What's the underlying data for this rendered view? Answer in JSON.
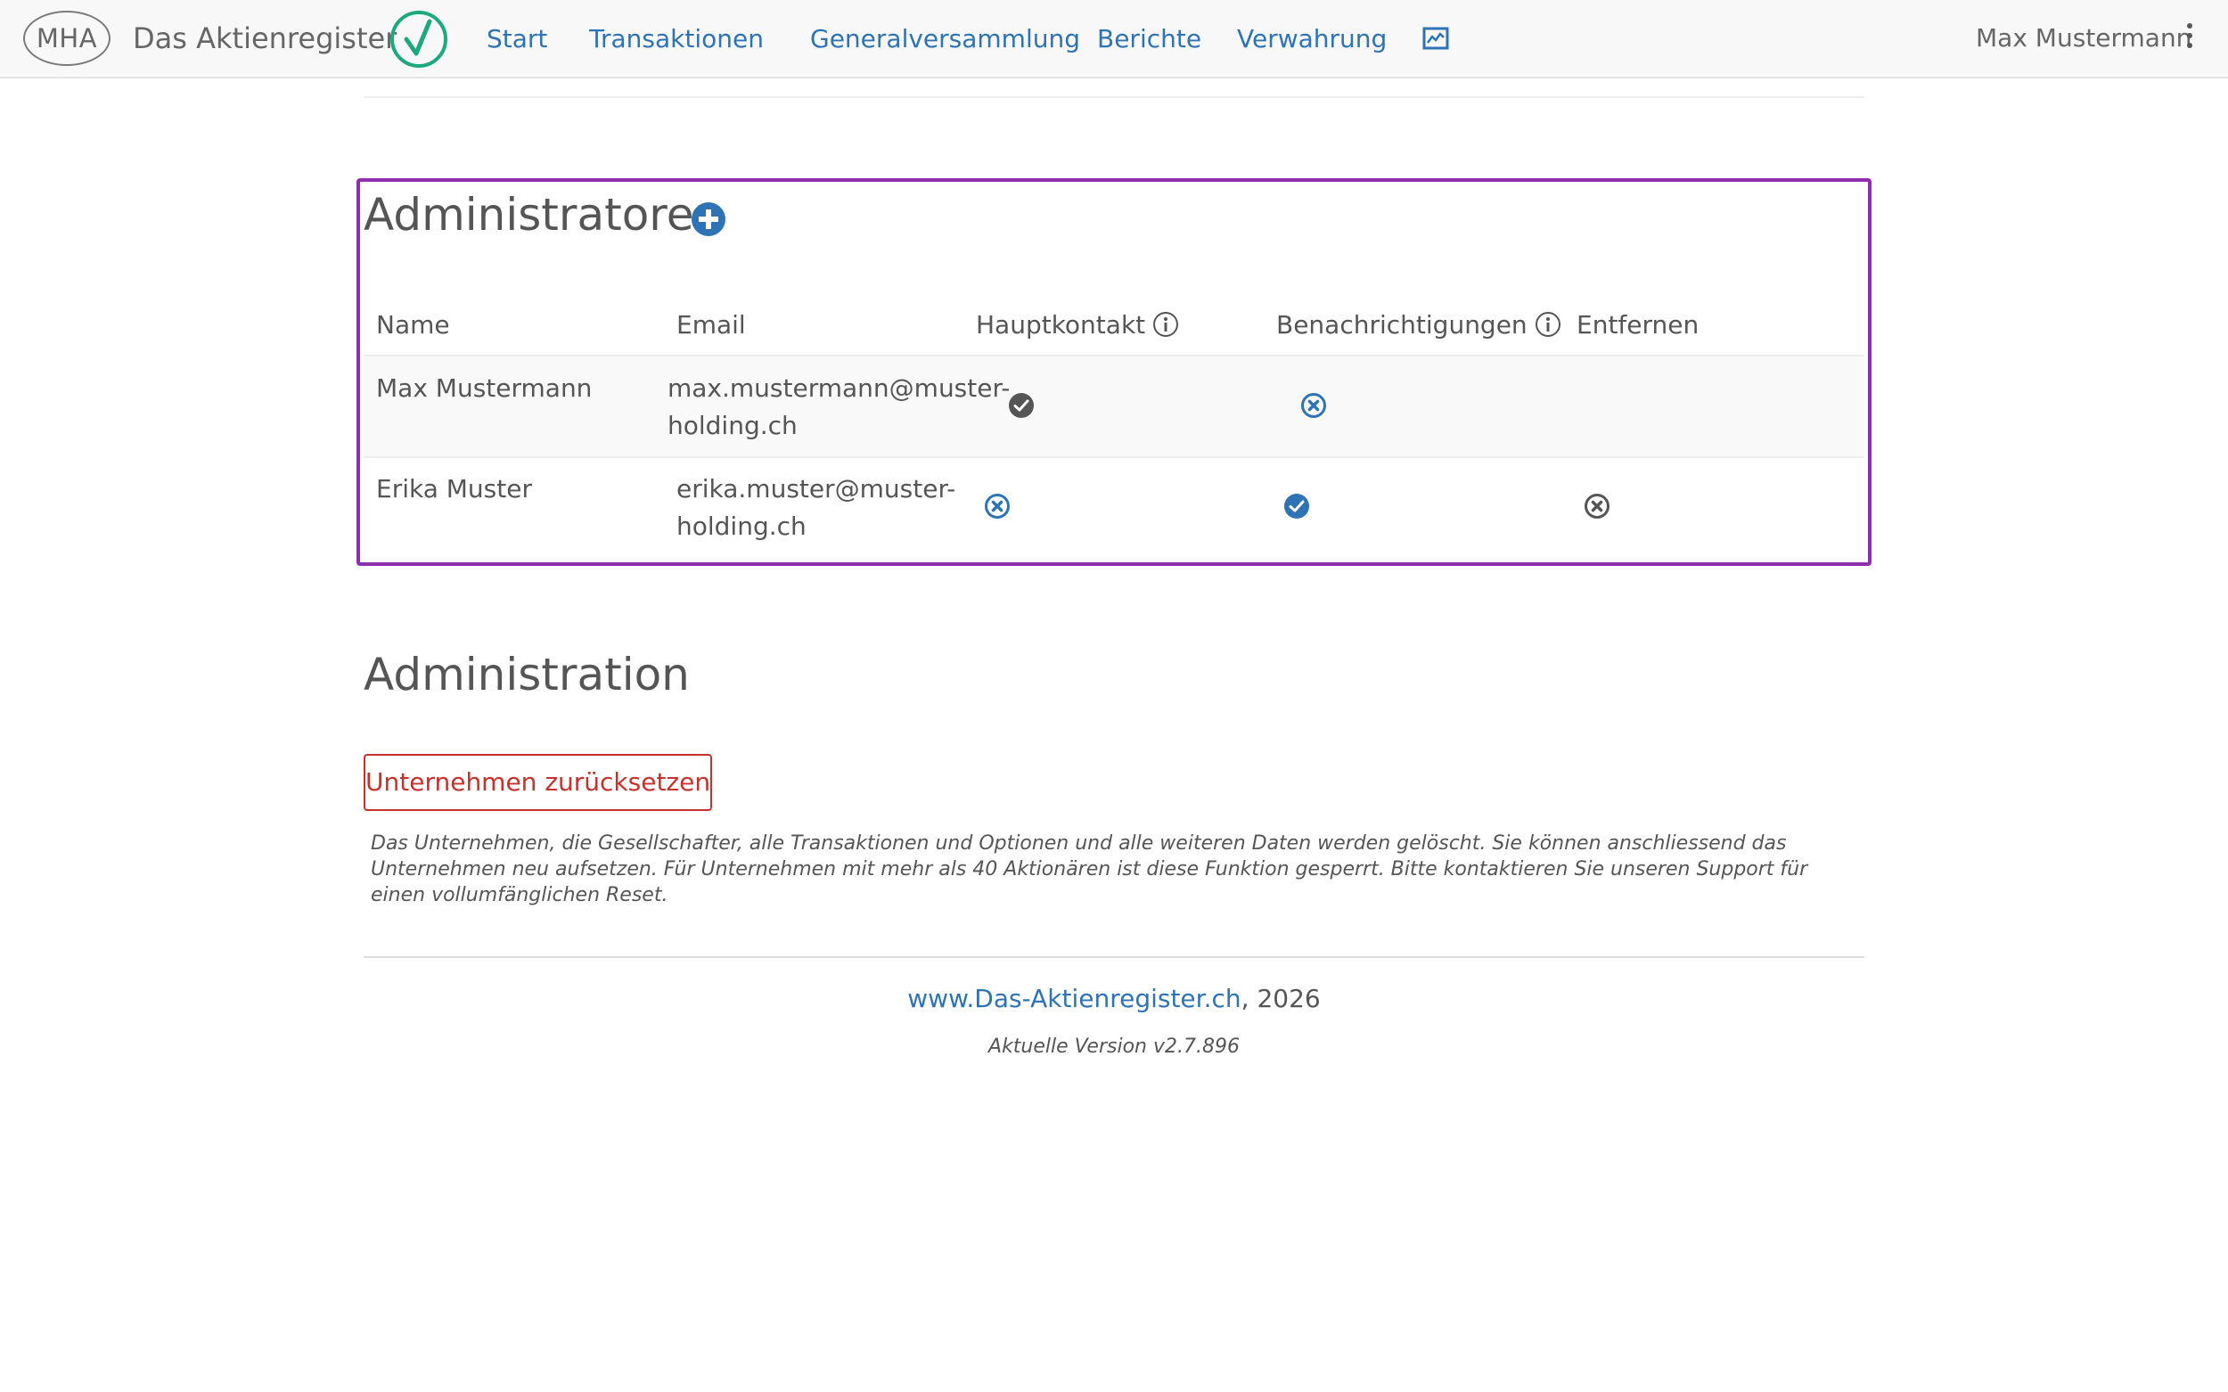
{
  "navbar": {
    "logo_text": "MHA",
    "brand": "Das Aktienregister",
    "links": [
      "Start",
      "Transaktionen",
      "Generalversammlung",
      "Berichte",
      "Verwahrung"
    ],
    "user": "Max Mustermann"
  },
  "admins": {
    "title": "Administratoren",
    "columns": [
      "Name",
      "Email",
      "Hauptkontakt",
      "Benachrichtigungen",
      "Entfernen"
    ],
    "rows": [
      {
        "name": "Max Mustermann",
        "email_line1": "max.mustermann@muster-",
        "email_line2": "holding.ch"
      },
      {
        "name": "Erika Muster",
        "email_line1": "erika.muster@muster-",
        "email_line2": "holding.ch"
      }
    ]
  },
  "administration": {
    "title": "Administration",
    "reset_button": "Unternehmen zurücksetzen",
    "reset_note": "Das Unternehmen, die Gesellschafter, alle Transaktionen und Optionen und alle weiteren Daten werden gelöscht. Sie können anschliessend das Unternehmen neu aufsetzen. Für Unternehmen mit mehr als 40 Aktionären ist diese Funktion gesperrt. Bitte kontaktieren Sie unseren Support für einen vollumfänglichen Reset."
  },
  "footer": {
    "link": "www.Das-Aktienregister.ch",
    "year_text": ", 2026",
    "version": "Aktuelle Version v2.7.896"
  },
  "colors": {
    "link_blue": "#2d73b6",
    "highlight_purple": "#8e2db0",
    "danger_red": "#c9302c",
    "logo_green": "#1ea97c"
  }
}
